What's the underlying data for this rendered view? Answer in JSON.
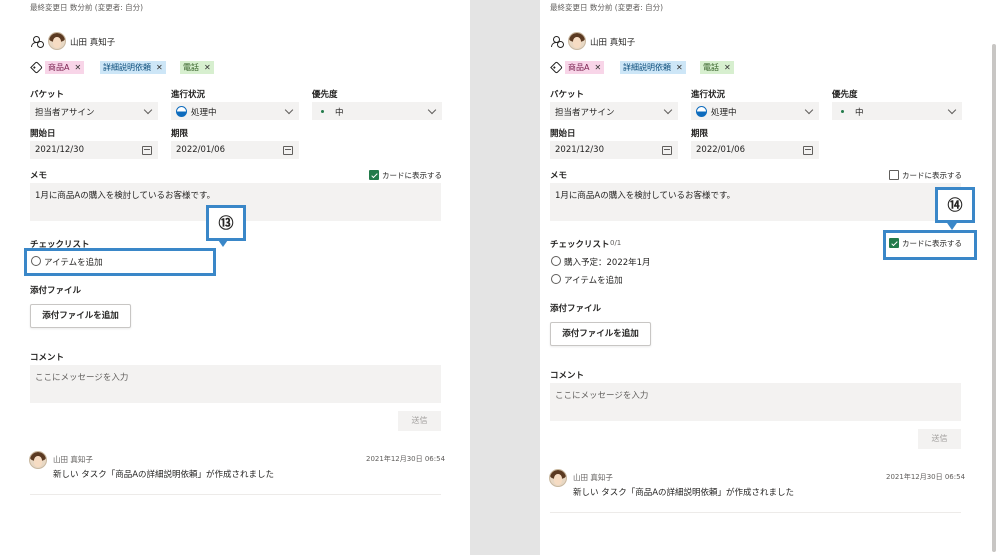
{
  "left": {
    "last_modified": "最終変更日 数分前 (変更者: 自分)",
    "assignee": "山田 真知子",
    "tags": [
      {
        "label": "商品A",
        "bg": "#f8d5e8",
        "fg": "#7a1f4f"
      },
      {
        "label": "詳細説明依頼",
        "bg": "#cde6f7",
        "fg": "#0b4c7a"
      },
      {
        "label": "電話",
        "bg": "#d7efcf",
        "fg": "#2d5a1f"
      }
    ],
    "bucket_label": "バケット",
    "bucket_value": "担当者アサイン",
    "progress_label": "進行状況",
    "progress_value": "処理中",
    "priority_label": "優先度",
    "priority_value": "中",
    "start_label": "開始日",
    "start_value": "2021/12/30",
    "due_label": "期限",
    "due_value": "2022/01/06",
    "memo_label": "メモ",
    "memo_show_on_card": "カードに表示する",
    "memo_text": "1月に商品Aの購入を検討しているお客様です。",
    "checklist_label": "チェックリスト",
    "add_item": "アイテムを追加",
    "attach_label": "添付ファイル",
    "attach_button": "添付ファイルを追加",
    "comment_label": "コメント",
    "comment_placeholder": "ここにメッセージを入力",
    "send_button": "送信",
    "activity_name": "山田 真知子",
    "activity_time": "2021年12月30日 06:54",
    "activity_text": "新しい タスク「商品Aの詳細説明依頼」が作成されました",
    "callout_number": "⑬"
  },
  "right": {
    "last_modified": "最終変更日 数分前 (変更者: 自分)",
    "assignee": "山田 真知子",
    "tags": [
      {
        "label": "商品A",
        "bg": "#f8d5e8",
        "fg": "#7a1f4f"
      },
      {
        "label": "詳細説明依頼",
        "bg": "#cde6f7",
        "fg": "#0b4c7a"
      },
      {
        "label": "電話",
        "bg": "#d7efcf",
        "fg": "#2d5a1f"
      }
    ],
    "bucket_label": "バケット",
    "bucket_value": "担当者アサイン",
    "progress_label": "進行状況",
    "progress_value": "処理中",
    "priority_label": "優先度",
    "priority_value": "中",
    "start_label": "開始日",
    "start_value": "2021/12/30",
    "due_label": "期限",
    "due_value": "2022/01/06",
    "memo_label": "メモ",
    "memo_show_on_card": "カードに表示する",
    "memo_text": "1月に商品Aの購入を検討しているお客様です。",
    "checklist_label": "チェックリスト",
    "checklist_count": "0/1",
    "checklist_show_on_card": "カードに表示する",
    "checklist_item": "購入予定：2022年1月",
    "add_item": "アイテムを追加",
    "attach_label": "添付ファイル",
    "attach_button": "添付ファイルを追加",
    "comment_label": "コメント",
    "comment_placeholder": "ここにメッセージを入力",
    "send_button": "送信",
    "activity_name": "山田 真知子",
    "activity_time": "2021年12月30日 06:54",
    "activity_text": "新しい タスク「商品Aの詳細説明依頼」が作成されました",
    "callout_number": "⑭"
  },
  "colors": {
    "callout": "#3a87c8",
    "check_green": "#237b4b",
    "field_bg": "#f3f2f1",
    "outer_bg": "#e4e4e4"
  }
}
